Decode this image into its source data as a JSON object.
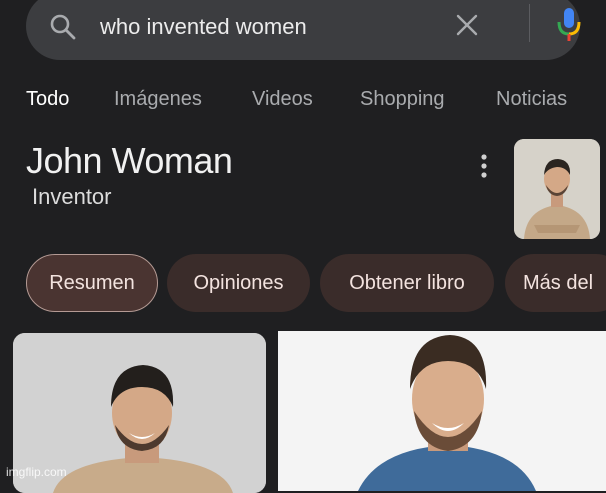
{
  "search": {
    "query": "who invented women",
    "icons": {
      "search": "search-icon",
      "clear": "close-icon",
      "voice": "microphone-icon"
    },
    "mic_colors": [
      "#4285f4",
      "#ea4335",
      "#fbbc05",
      "#34a853"
    ]
  },
  "tabs": [
    {
      "label": "Todo",
      "active": true
    },
    {
      "label": "Imágenes",
      "active": false
    },
    {
      "label": "Videos",
      "active": false
    },
    {
      "label": "Shopping",
      "active": false
    },
    {
      "label": "Noticias",
      "active": false
    }
  ],
  "knowledge_panel": {
    "title": "John Woman",
    "subtitle": "Inventor",
    "menu_icon": "more-vert-icon"
  },
  "chips": [
    {
      "label": "Resumen",
      "selected": true
    },
    {
      "label": "Opiniones",
      "selected": false
    },
    {
      "label": "Obtener libro",
      "selected": false
    },
    {
      "label": "Más del",
      "selected": false
    }
  ],
  "watermark": "imgflip.com",
  "colors": {
    "background": "#1f1f21",
    "search_bar": "#3c3d40",
    "chip": "#3a2c2a",
    "chip_text": "#f3e3df"
  }
}
